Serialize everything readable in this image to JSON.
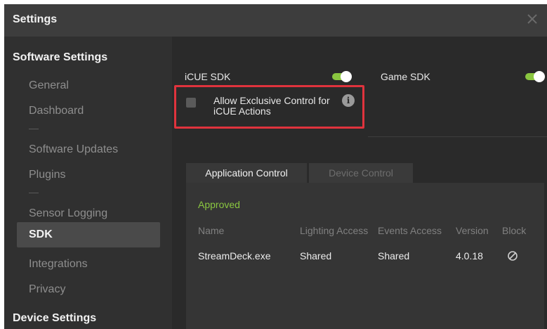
{
  "window": {
    "title": "Settings",
    "close_icon": "close-icon"
  },
  "sidebar": {
    "software_header": "Software Settings",
    "items": [
      "General",
      "Dashboard",
      "Software Updates",
      "Plugins",
      "Sensor Logging",
      "SDK",
      "Integrations",
      "Privacy"
    ],
    "active_item": "SDK",
    "device_header": "Device Settings"
  },
  "sdk": {
    "icue_sdk_label": "iCUE SDK",
    "icue_sdk_enabled": true,
    "game_sdk_label": "Game SDK",
    "game_sdk_enabled": true,
    "exclusive_line1": "Allow Exclusive Control for",
    "exclusive_line2": "iCUE Actions",
    "exclusive_checked": false,
    "info_glyph": "i"
  },
  "tabs": {
    "application_control": "Application Control",
    "device_control": "Device Control",
    "active": "Application Control"
  },
  "app_control": {
    "status": "Approved",
    "columns": [
      "Name",
      "Lighting Access",
      "Events Access",
      "Version",
      "Block"
    ],
    "rows": [
      {
        "name": "StreamDeck.exe",
        "lighting": "Shared",
        "events": "Shared",
        "version": "4.0.18",
        "block_icon": "block-icon"
      }
    ]
  },
  "colors": {
    "accent_green": "#8ac640",
    "highlight_red": "#e0333d",
    "background": "#2a2a2a",
    "sidebar": "#303030"
  }
}
